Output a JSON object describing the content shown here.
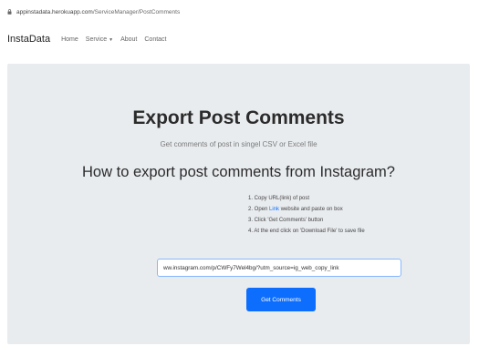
{
  "browser": {
    "url_domain": "appinstadata.herokuapp.com",
    "url_path": "/ServiceManager/PostComments"
  },
  "navbar": {
    "brand": "InstaData",
    "links": [
      "Home",
      "Service",
      "About",
      "Contact"
    ],
    "dropdown_caret": "▼"
  },
  "main": {
    "title": "Export Post Comments",
    "subtitle": "Get comments of post in singel CSV or Excel file",
    "howto_heading": "How to export post comments from Instagram?",
    "steps": [
      "1. Copy URL(link) of post",
      {
        "before": "2. Open ",
        "link": "Link",
        "after": " website and paste on box"
      },
      "3. Click 'Get Comments' button",
      "4. At the end click on 'Download File' to save file"
    ],
    "url_input_value": "ww.instagram.com/p/CWFy7Wel4bg/?utm_source=ig_web_copy_link",
    "button_label": "Get Comments"
  },
  "colors": {
    "accent": "#0d6efd",
    "card_bg": "#e9ecef"
  },
  "icons": [
    "lock-icon"
  ]
}
